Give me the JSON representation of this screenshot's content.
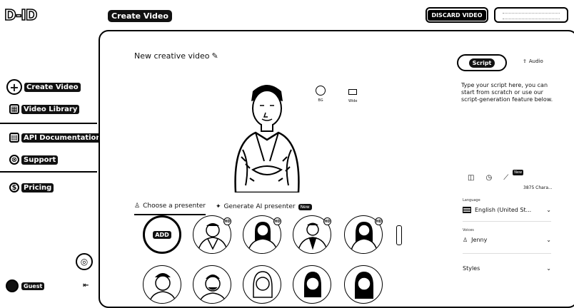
{
  "app": {
    "logo_text": "D-ID"
  },
  "header": {
    "page_title": "Create Video",
    "discard_label": "DISCARD VIDEO",
    "generate_label": ""
  },
  "sidebar": {
    "items": [
      {
        "label": "Create Video",
        "icon": "plus-icon"
      },
      {
        "label": "Video Library",
        "icon": "grid-icon"
      },
      {
        "label": "API Documentation",
        "icon": "document-icon"
      },
      {
        "label": "Support",
        "icon": "lifebuoy-icon"
      },
      {
        "label": "Pricing",
        "icon": "dollar-icon"
      }
    ],
    "user_name": "Guest"
  },
  "editor": {
    "video_title": "New creative video",
    "options": [
      {
        "label": "BG",
        "icon": "circle-icon"
      },
      {
        "label": "Wide",
        "icon": "rectangle-icon"
      }
    ],
    "tabs": [
      {
        "label": "Choose a presenter",
        "active": true
      },
      {
        "label": "Generate AI presenter",
        "badge": "New",
        "active": false
      }
    ],
    "presenters": {
      "add_label": "ADD",
      "hd_badge": "HD"
    }
  },
  "script_panel": {
    "script_tab": "Script",
    "audio_tab": "Audio",
    "placeholder": "Type your script here, you can start from scratch or use our script-generation feature below.",
    "new_badge": "New",
    "char_count": "3875 Chara...",
    "language_label": "Language",
    "language_value": "English (United St...",
    "voices_label": "Voices",
    "voice_value": "Jenny",
    "styles_label": "Styles"
  }
}
